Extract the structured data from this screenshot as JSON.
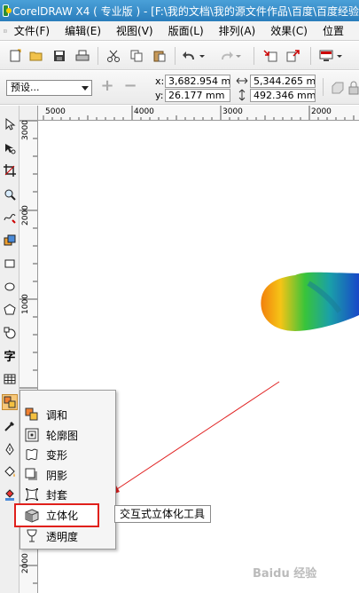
{
  "window": {
    "title": "CorelDRAW X4 ( 专业版 ) - [F:\\我的文档\\我的源文件作品\\百度\\百度经验"
  },
  "menubar": {
    "items": [
      "文件(F)",
      "编辑(E)",
      "视图(V)",
      "版面(L)",
      "排列(A)",
      "效果(C)",
      "位置"
    ]
  },
  "property_bar": {
    "preset": "预设...",
    "x_label": "x:",
    "y_label": "y:",
    "x_value": "3,682.954 mm",
    "y_value": "26.177 mm",
    "width_value": "5,344.265 mm",
    "height_value": "492.346 mm"
  },
  "ruler": {
    "top_labels": [
      "5000",
      "4000",
      "3000",
      "2000"
    ],
    "left_labels": [
      "3000",
      "2000",
      "1000",
      "0",
      "2000"
    ]
  },
  "flyout": {
    "items": [
      "调和",
      "轮廓图",
      "变形",
      "阴影",
      "封套",
      "立体化",
      "透明度"
    ]
  },
  "tooltip": "交互式立体化工具",
  "watermark": "Baidu 经验"
}
